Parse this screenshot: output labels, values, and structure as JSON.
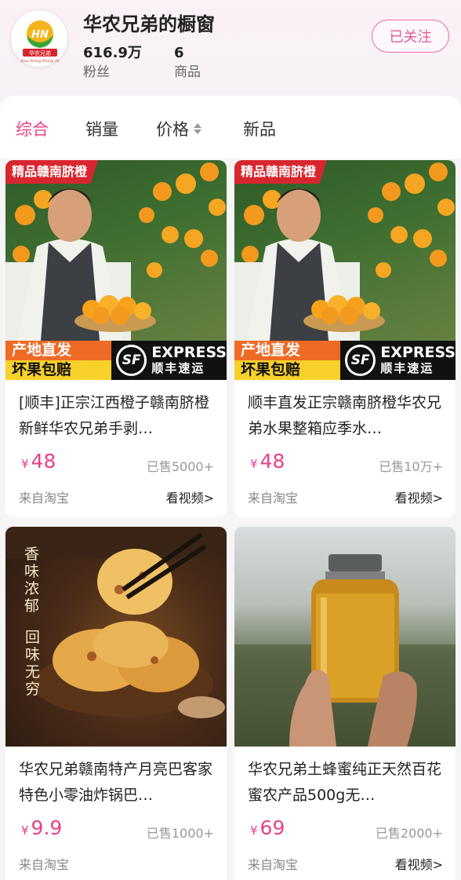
{
  "store": {
    "name": "华农兄弟的橱窗",
    "fans_count": "616.9万",
    "fans_label": "粉丝",
    "goods_count": "6",
    "goods_label": "商品",
    "follow_label": "已关注",
    "logo_text": "华农兄弟",
    "logo_sub": "Hua Nong Xiong Di"
  },
  "tabs": [
    {
      "label": "综合",
      "active": true
    },
    {
      "label": "销量",
      "active": false
    },
    {
      "label": "价格",
      "active": false
    },
    {
      "label": "新品",
      "active": false
    }
  ],
  "products": [
    {
      "title": "[顺丰]正宗江西橙子赣南脐橙新鲜华农兄弟手剥…",
      "currency": "¥",
      "price": "48",
      "sold": "已售5000+",
      "source": "来自淘宝",
      "video": "看视频>",
      "badge": "精品赣南脐橙",
      "banner_1": "产地直发",
      "banner_2": "坏果包赔",
      "sf_logo": "SF",
      "sf_express": "EXPRESS",
      "sf_cn": "顺丰速运"
    },
    {
      "title": "顺丰直发正宗赣南脐橙华农兄弟水果整箱应季水…",
      "currency": "¥",
      "price": "48",
      "sold": "已售10万+",
      "source": "来自淘宝",
      "video": "看视频>",
      "badge": "精品赣南脐橙",
      "banner_1": "产地直发",
      "banner_2": "坏果包赔",
      "sf_logo": "SF",
      "sf_express": "EXPRESS",
      "sf_cn": "顺丰速运"
    },
    {
      "title": "华农兄弟赣南特产月亮巴客家特色小零油炸锅巴…",
      "currency": "¥",
      "price": "9.9",
      "sold": "已售1000+",
      "source": "来自淘宝",
      "img_text_1": "香味浓郁",
      "img_text_2": "回味无穷"
    },
    {
      "title": "华农兄弟土蜂蜜纯正天然百花蜜农产品500g无…",
      "currency": "¥",
      "price": "69",
      "sold": "已售2000+",
      "source": "来自淘宝",
      "video": "看视频>"
    }
  ],
  "colors": {
    "accent": "#e9418a",
    "follow_border": "#e96aa3",
    "badge_red": "#d8262e",
    "banner_orange": "#ef6a24",
    "banner_yellow": "#f7d12a"
  }
}
